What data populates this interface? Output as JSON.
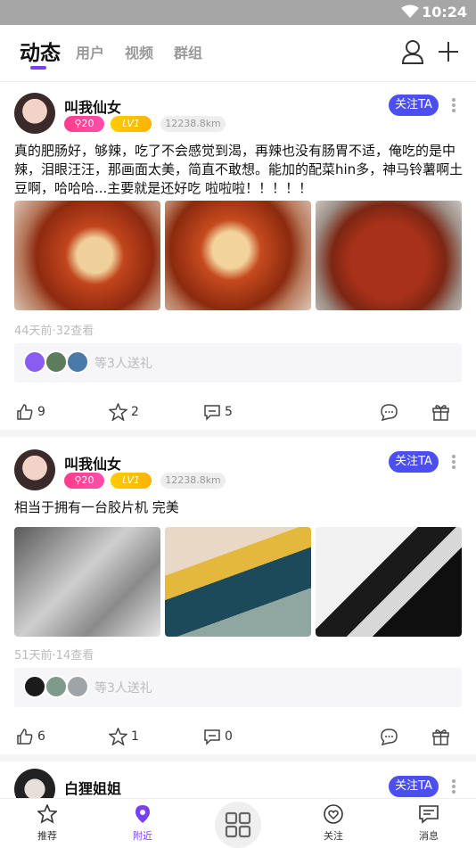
{
  "status": {
    "time": "10:24"
  },
  "nav": {
    "tabs": [
      {
        "label": "动态"
      },
      {
        "label": "用户"
      },
      {
        "label": "视频"
      },
      {
        "label": "群组"
      }
    ]
  },
  "posts": [
    {
      "username": "叫我仙女",
      "fans_badge": "20",
      "level": "LV1",
      "distance": "12238.8km",
      "follow_label": "关注TA",
      "text": "真的肥肠好，够辣，吃了不会感觉到渴，再辣也没有肠胃不适，俺吃的是中辣，泪眼汪汪，那画面太美，简直不敢想。能加的配菜hin多，神马铃薯啊土豆啊，哈哈哈...主要就是还好吃    啦啦啦！！！！！",
      "meta": "44天前·32查看",
      "gift_text": "等3人送礼",
      "likes": "9",
      "stars": "2",
      "comments": "5"
    },
    {
      "username": "叫我仙女",
      "fans_badge": "20",
      "level": "LV1",
      "distance": "12238.8km",
      "follow_label": "关注TA",
      "text": "相当于拥有一台胶片机       完美",
      "meta": "51天前·14查看",
      "gift_text": "等3人送礼",
      "likes": "6",
      "stars": "1",
      "comments": "0"
    },
    {
      "username": "白狸姐姐",
      "follow_label": "关注TA"
    }
  ],
  "bottom_nav": [
    {
      "label": "推荐",
      "icon": "star-icon"
    },
    {
      "label": "附近",
      "icon": "location-pin-icon"
    },
    {
      "label": "",
      "icon": "grid-icon"
    },
    {
      "label": "关注",
      "icon": "heart-icon"
    },
    {
      "label": "消息",
      "icon": "message-icon"
    }
  ],
  "colors": {
    "accent": "#7b3ff2",
    "follow": "#4c4ff0",
    "fans": "#ff3d8b",
    "level": "#ffc400"
  }
}
